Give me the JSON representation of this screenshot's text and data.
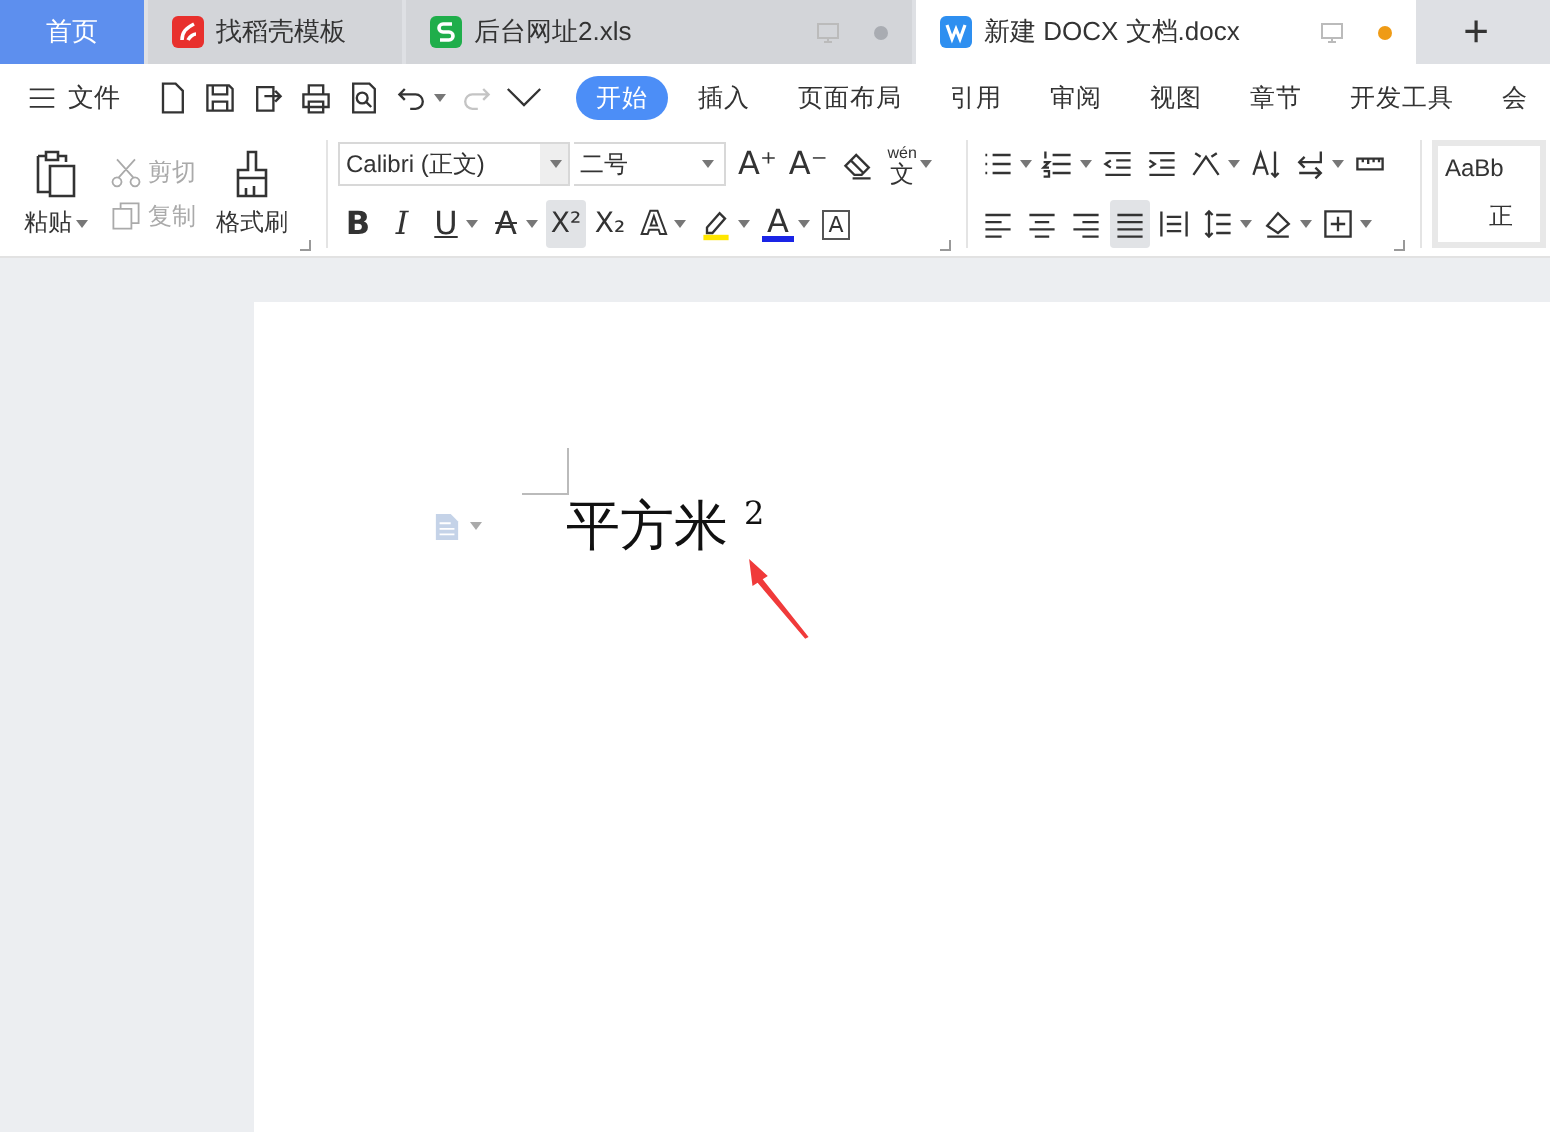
{
  "tabs": [
    {
      "kind": "home",
      "label": "首页",
      "selected": false
    },
    {
      "kind": "docer",
      "label": "找稻壳模板",
      "selected": false
    },
    {
      "kind": "sheet",
      "label": "后台网址2.xls",
      "selected": false,
      "modified": false
    },
    {
      "kind": "writer",
      "label": "新建 DOCX 文档.docx",
      "selected": true,
      "modified": true
    }
  ],
  "new_tab": "+",
  "file_menu": "文件",
  "quick_access": [
    {
      "kind": "new",
      "disabled": false,
      "dropdown": false
    },
    {
      "kind": "save",
      "disabled": false,
      "dropdown": false
    },
    {
      "kind": "export",
      "disabled": false,
      "dropdown": false
    },
    {
      "kind": "print",
      "disabled": false,
      "dropdown": false
    },
    {
      "kind": "preview",
      "disabled": false,
      "dropdown": false
    },
    {
      "kind": "undo",
      "disabled": false,
      "dropdown": true
    },
    {
      "kind": "redo",
      "disabled": true,
      "dropdown": false
    },
    {
      "kind": "more",
      "disabled": false,
      "dropdown": false
    }
  ],
  "ribbon_tabs": [
    {
      "label": "开始",
      "selected": true
    },
    {
      "label": "插入",
      "selected": false
    },
    {
      "label": "页面布局",
      "selected": false
    },
    {
      "label": "引用",
      "selected": false
    },
    {
      "label": "审阅",
      "selected": false
    },
    {
      "label": "视图",
      "selected": false
    },
    {
      "label": "章节",
      "selected": false
    },
    {
      "label": "开发工具",
      "selected": false
    },
    {
      "label": "会",
      "selected": false
    }
  ],
  "clipboard": {
    "paste": "粘贴",
    "cut": {
      "label": "剪切",
      "disabled": true
    },
    "copy": {
      "label": "复制",
      "disabled": true
    },
    "format_painter": "格式刷"
  },
  "font": {
    "name": "Calibri (正文)",
    "size": "二号",
    "row_1": [
      {
        "kind": "grow",
        "text": "A⁺",
        "selected": false,
        "dropdown": false
      },
      {
        "kind": "shrink",
        "text": "A⁻",
        "selected": false,
        "dropdown": false
      },
      {
        "kind": "eraser",
        "selected": false,
        "dropdown": false
      },
      {
        "kind": "ruby",
        "text": "文",
        "ruby": "wén",
        "selected": false,
        "dropdown": true
      }
    ],
    "row_2": [
      {
        "kind": "bold",
        "text": "B",
        "selected": false,
        "dropdown": false
      },
      {
        "kind": "italic",
        "text": "I",
        "selected": false,
        "dropdown": false
      },
      {
        "kind": "underline",
        "text": "U",
        "selected": false,
        "dropdown": true
      },
      {
        "kind": "strike",
        "text": "A",
        "selected": false,
        "dropdown": true
      },
      {
        "kind": "sup",
        "text": "X²",
        "selected": true,
        "dropdown": false
      },
      {
        "kind": "sub",
        "text": "X₂",
        "selected": false,
        "dropdown": false
      },
      {
        "kind": "effect",
        "text": "A",
        "selected": false,
        "dropdown": true
      },
      {
        "kind": "highlight",
        "selected": false,
        "dropdown": true
      },
      {
        "kind": "fontcolor",
        "text": "A",
        "selected": false,
        "dropdown": true
      },
      {
        "kind": "charborder",
        "text": "A",
        "selected": false,
        "dropdown": false
      }
    ]
  },
  "paragraph": {
    "row_1": [
      {
        "kind": "bullets",
        "selected": false,
        "dropdown": true
      },
      {
        "kind": "numbering",
        "selected": false,
        "dropdown": true
      },
      {
        "kind": "outdent",
        "selected": false,
        "dropdown": false
      },
      {
        "kind": "indent",
        "selected": false,
        "dropdown": false
      },
      {
        "kind": "layout",
        "selected": false,
        "dropdown": true
      },
      {
        "kind": "sort",
        "selected": false,
        "dropdown": false
      },
      {
        "kind": "marks",
        "selected": false,
        "dropdown": true
      },
      {
        "kind": "tabs",
        "selected": false,
        "dropdown": false
      }
    ],
    "row_2": [
      {
        "kind": "left",
        "selected": false,
        "dropdown": false
      },
      {
        "kind": "center",
        "selected": false,
        "dropdown": false
      },
      {
        "kind": "right",
        "selected": false,
        "dropdown": false
      },
      {
        "kind": "justify",
        "selected": true,
        "dropdown": false
      },
      {
        "kind": "distributed",
        "selected": false,
        "dropdown": false
      },
      {
        "kind": "spacing",
        "selected": false,
        "dropdown": true
      },
      {
        "kind": "shading",
        "selected": false,
        "dropdown": true
      },
      {
        "kind": "borders",
        "selected": false,
        "dropdown": true
      }
    ]
  },
  "styles": {
    "preview": "AaBb",
    "name": "正"
  },
  "document": {
    "text": "平方米$^{2}$"
  }
}
